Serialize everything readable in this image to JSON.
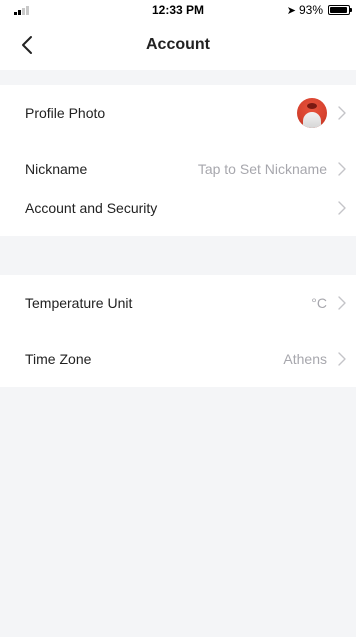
{
  "status_bar": {
    "time": "12:33 PM",
    "battery_percent_label": "93%",
    "battery_level": 0.93
  },
  "header": {
    "title": "Account",
    "back_icon": "chevron-left-icon"
  },
  "groups": [
    {
      "rows": [
        {
          "label": "Profile Photo",
          "value": ""
        },
        {
          "label": "Nickname",
          "value": "Tap to Set Nickname"
        }
      ]
    },
    {
      "rows": [
        {
          "label": "Account and Security",
          "value": ""
        }
      ]
    },
    {
      "rows": [
        {
          "label": "Temperature Unit",
          "value": "°C"
        },
        {
          "label": "Time Zone",
          "value": "Athens"
        }
      ]
    }
  ],
  "colors": {
    "background": "#f4f5f7",
    "row_background": "#ffffff",
    "secondary_text": "#a7a7ad",
    "avatar_accent": "#d8432f"
  }
}
